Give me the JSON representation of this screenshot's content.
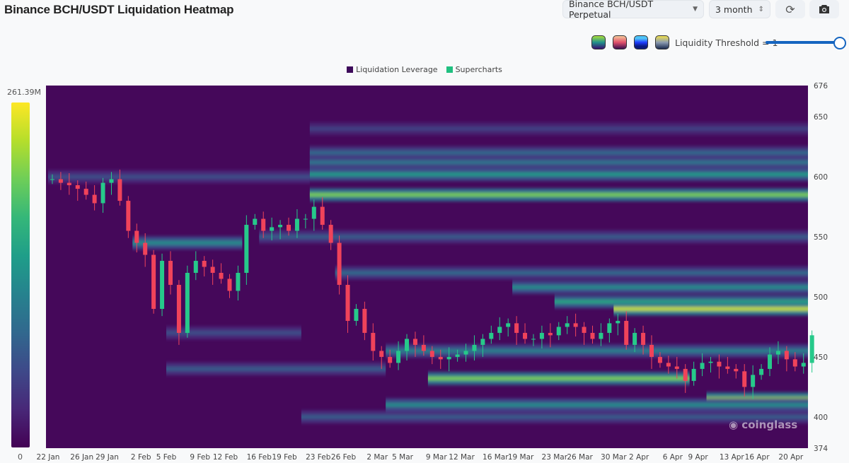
{
  "header": {
    "title": "Binance BCH/USDT Liquidation Heatmap",
    "pair_select": "Binance BCH/USDT Perpetual",
    "range_select": "3 month",
    "refresh_icon": "refresh-icon",
    "camera_icon": "camera-icon"
  },
  "controls": {
    "threshold_label": "Liquidity Threshold = 1",
    "threshold_value": 1,
    "palettes": [
      "viridis",
      "magma",
      "blue",
      "cividis"
    ]
  },
  "watermark": "coinglass",
  "chart_data": {
    "type": "heatmap",
    "title": "Binance BCH/USDT Liquidation Heatmap",
    "legend": [
      {
        "name": "Liquidation Leverage",
        "color": "#3d0a5a"
      },
      {
        "name": "Supercharts",
        "color": "#20c080"
      }
    ],
    "legend_position": "top-center",
    "colorbar": {
      "max_label": "261.39M",
      "min_label": "0"
    },
    "ylim": [
      374,
      676
    ],
    "yticks": [
      676,
      650,
      600,
      550,
      500,
      450,
      400,
      374
    ],
    "xticks": [
      "22 Jan",
      "26 Jan",
      "29 Jan",
      "2 Feb",
      "5 Feb",
      "9 Feb",
      "12 Feb",
      "16 Feb",
      "19 Feb",
      "23 Feb",
      "26 Feb",
      "2 Mar",
      "5 Mar",
      "9 Mar",
      "12 Mar",
      "16 Mar",
      "19 Mar",
      "23 Mar",
      "26 Mar",
      "30 Mar",
      "2 Apr",
      "6 Apr",
      "9 Apr",
      "13 Apr",
      "16 Apr",
      "20 Apr"
    ],
    "xtick_days": [
      0,
      4,
      7,
      11,
      14,
      18,
      21,
      25,
      28,
      32,
      35,
      39,
      42,
      46,
      49,
      53,
      56,
      60,
      63,
      67,
      70,
      74,
      77,
      81,
      84,
      88
    ],
    "start_date": "22 Jan",
    "days": 91,
    "closes": [
      598,
      595,
      593,
      590,
      585,
      578,
      595,
      598,
      580,
      555,
      545,
      535,
      490,
      530,
      510,
      470,
      520,
      530,
      525,
      520,
      515,
      505,
      520,
      560,
      565,
      555,
      558,
      560,
      555,
      565,
      565,
      575,
      560,
      545,
      510,
      480,
      490,
      470,
      455,
      450,
      445,
      455,
      465,
      460,
      455,
      450,
      448,
      450,
      452,
      455,
      460,
      465,
      470,
      475,
      478,
      470,
      465,
      465,
      470,
      468,
      475,
      478,
      475,
      470,
      465,
      470,
      478,
      480,
      460,
      470,
      460,
      450,
      445,
      442,
      440,
      430,
      440,
      445,
      446,
      442,
      440,
      438,
      425,
      435,
      440,
      452,
      455,
      448,
      442,
      445,
      468
    ],
    "bands": [
      {
        "price": 600,
        "strength": 0.25,
        "from": 0,
        "to": 31
      },
      {
        "price": 602,
        "strength": 0.55,
        "from": 31,
        "to": 91
      },
      {
        "price": 585,
        "strength": 0.8,
        "from": 31,
        "to": 91
      },
      {
        "price": 620,
        "strength": 0.35,
        "from": 31,
        "to": 91
      },
      {
        "price": 612,
        "strength": 0.4,
        "from": 31,
        "to": 91
      },
      {
        "price": 640,
        "strength": 0.2,
        "from": 31,
        "to": 91
      },
      {
        "price": 545,
        "strength": 0.5,
        "from": 10,
        "to": 23
      },
      {
        "price": 550,
        "strength": 0.3,
        "from": 25,
        "to": 91
      },
      {
        "price": 520,
        "strength": 0.35,
        "from": 34,
        "to": 91
      },
      {
        "price": 508,
        "strength": 0.5,
        "from": 55,
        "to": 91
      },
      {
        "price": 496,
        "strength": 0.6,
        "from": 60,
        "to": 91
      },
      {
        "price": 490,
        "strength": 0.92,
        "from": 67,
        "to": 91
      },
      {
        "price": 455,
        "strength": 0.45,
        "from": 40,
        "to": 91
      },
      {
        "price": 432,
        "strength": 0.8,
        "from": 45,
        "to": 76
      },
      {
        "price": 415,
        "strength": 0.88,
        "from": 78,
        "to": 91
      },
      {
        "price": 410,
        "strength": 0.5,
        "from": 40,
        "to": 91
      },
      {
        "price": 400,
        "strength": 0.3,
        "from": 30,
        "to": 91
      },
      {
        "price": 440,
        "strength": 0.3,
        "from": 14,
        "to": 40
      },
      {
        "price": 470,
        "strength": 0.25,
        "from": 14,
        "to": 30
      }
    ]
  }
}
